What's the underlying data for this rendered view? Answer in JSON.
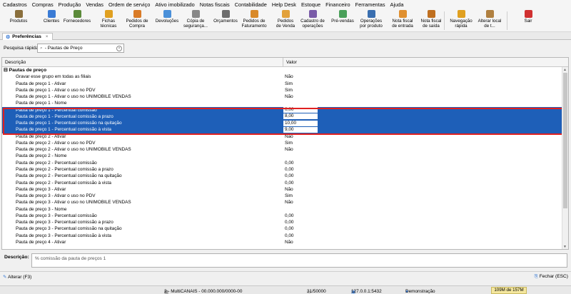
{
  "menu": [
    "Cadastros",
    "Compras",
    "Produção",
    "Vendas",
    "Ordem de serviço",
    "Ativo imobilizado",
    "Notas fiscais",
    "Contabilidade",
    "Help Desk",
    "Estoque",
    "Financeiro",
    "Ferramentas",
    "Ajuda"
  ],
  "toolbar": [
    {
      "label": "Produtos",
      "icon": "box-icon",
      "color": "#8a6f3c"
    },
    {
      "label": "Clientes",
      "icon": "person-icon",
      "color": "#3a7bd5"
    },
    {
      "label": "Fornecedores",
      "icon": "supplier-icon",
      "color": "#5b8a3a"
    },
    {
      "label": "Fichas\ntécnicas",
      "icon": "document-icon",
      "color": "#e0a020"
    },
    {
      "label": "Pedidos de\nCompra",
      "icon": "cart-icon",
      "color": "#d97b27"
    },
    {
      "label": "Devoluções",
      "icon": "return-icon",
      "color": "#4a90d9"
    },
    {
      "label": "Cópia de\nsegurança...",
      "icon": "backup-icon",
      "color": "#888888"
    },
    {
      "label": "Orçamentos",
      "icon": "calculator-icon",
      "color": "#6d6d6d"
    },
    {
      "label": "Pedidos de\nFaturamento",
      "icon": "invoice-icon",
      "color": "#d98a2a"
    },
    {
      "label": "Pedidos\nde Venda",
      "icon": "sales-order-icon",
      "color": "#e2a13b"
    },
    {
      "label": "Cadastro de\noperações",
      "icon": "operations-icon",
      "color": "#7a5ca8"
    },
    {
      "label": "Pré-vendas",
      "icon": "presale-cart-icon",
      "color": "#4aa05a"
    },
    {
      "label": "Operações\npor produto",
      "icon": "product-ops-icon",
      "color": "#3a6fb0"
    },
    {
      "label": "Nota fiscal\nde entrada",
      "icon": "invoice-in-icon",
      "color": "#e09030"
    },
    {
      "label": "Nota fiscal\nde saída",
      "icon": "invoice-out-icon",
      "color": "#c07020"
    },
    {
      "label": "Navegação\nrápida",
      "icon": "quick-nav-icon",
      "color": "#e0a020"
    },
    {
      "label": "Alterar local\nde t...",
      "icon": "home-icon",
      "color": "#b08040"
    },
    {
      "label": "Sair",
      "icon": "exit-icon",
      "color": "#d03030"
    }
  ],
  "tab": {
    "title": "Preferências",
    "close": "×"
  },
  "search": {
    "label": "Pesquisa rápida",
    "value": "- Pautas de Preço"
  },
  "grid": {
    "col_desc": "Descrição",
    "col_value": "Valor",
    "rows": [
      {
        "d": "⊟ Pautas de preço",
        "v": "",
        "group": true
      },
      {
        "d": "Gravar esse grupo em todas as filiais",
        "v": "Não"
      },
      {
        "d": "Pauta de preço 1 - Ativar",
        "v": "Sim"
      },
      {
        "d": "Pauta de preço 1 - Ativar o uso no PDV",
        "v": "Sim"
      },
      {
        "d": "Pauta de preço 1 - Ativar o uso no UNIMOBILE VENDAS",
        "v": "Não"
      },
      {
        "d": "Pauta de preço 1 - Nome",
        "v": ""
      },
      {
        "d": "Pauta de preço 1 - Percentual comissão",
        "v": "0,00",
        "sel": true
      },
      {
        "d": "Pauta de preço 1 - Percentual comissão a prazo",
        "v": "8,00",
        "sel": true
      },
      {
        "d": "Pauta de preço 1 - Percentual comissão na quitação",
        "v": "10,00",
        "sel": true
      },
      {
        "d": "Pauta de preço 1 - Percentual comissão à vista",
        "v": "9,00",
        "sel": true
      },
      {
        "d": "Pauta de preço 2 - Ativar",
        "v": "Não"
      },
      {
        "d": "Pauta de preço 2 - Ativar o uso no PDV",
        "v": "Sim"
      },
      {
        "d": "Pauta de preço 2 - Ativar o uso no UNIMOBILE VENDAS",
        "v": "Não"
      },
      {
        "d": "Pauta de preço 2 - Nome",
        "v": ""
      },
      {
        "d": "Pauta de preço 2 - Percentual comissão",
        "v": "0,00"
      },
      {
        "d": "Pauta de preço 2 - Percentual comissão a prazo",
        "v": "0,00"
      },
      {
        "d": "Pauta de preço 2 - Percentual comissão na quitação",
        "v": "0,00"
      },
      {
        "d": "Pauta de preço 2 - Percentual comissão à vista",
        "v": "0,00"
      },
      {
        "d": "Pauta de preço 3 - Ativar",
        "v": "Não"
      },
      {
        "d": "Pauta de preço 3 - Ativar o uso no PDV",
        "v": "Sim"
      },
      {
        "d": "Pauta de preço 3 - Ativar o uso no UNIMOBILE VENDAS",
        "v": "Não"
      },
      {
        "d": "Pauta de preço 3 - Nome",
        "v": ""
      },
      {
        "d": "Pauta de preço 3 - Percentual comissão",
        "v": "0,00"
      },
      {
        "d": "Pauta de preço 3 - Percentual comissão a prazo",
        "v": "0,00"
      },
      {
        "d": "Pauta de preço 3 - Percentual comissão na quitação",
        "v": "0,00"
      },
      {
        "d": "Pauta de preço 3 - Percentual comissão à vista",
        "v": "0,00"
      },
      {
        "d": "Pauta de preço 4 - Ativar",
        "v": "Não"
      }
    ]
  },
  "description": {
    "label": "Descrição:",
    "text": "% comissão da pauta de preços 1"
  },
  "footer": {
    "alter": "Alterar (F3)",
    "close": "Fechar (ESC)"
  },
  "status": {
    "company": "2 - MultiCANAIS - 00.000.000/0000-00",
    "records": "31/50000",
    "server": "127.0.0.1:5432",
    "user": "Demonstração",
    "memory": "109M de 157M"
  }
}
